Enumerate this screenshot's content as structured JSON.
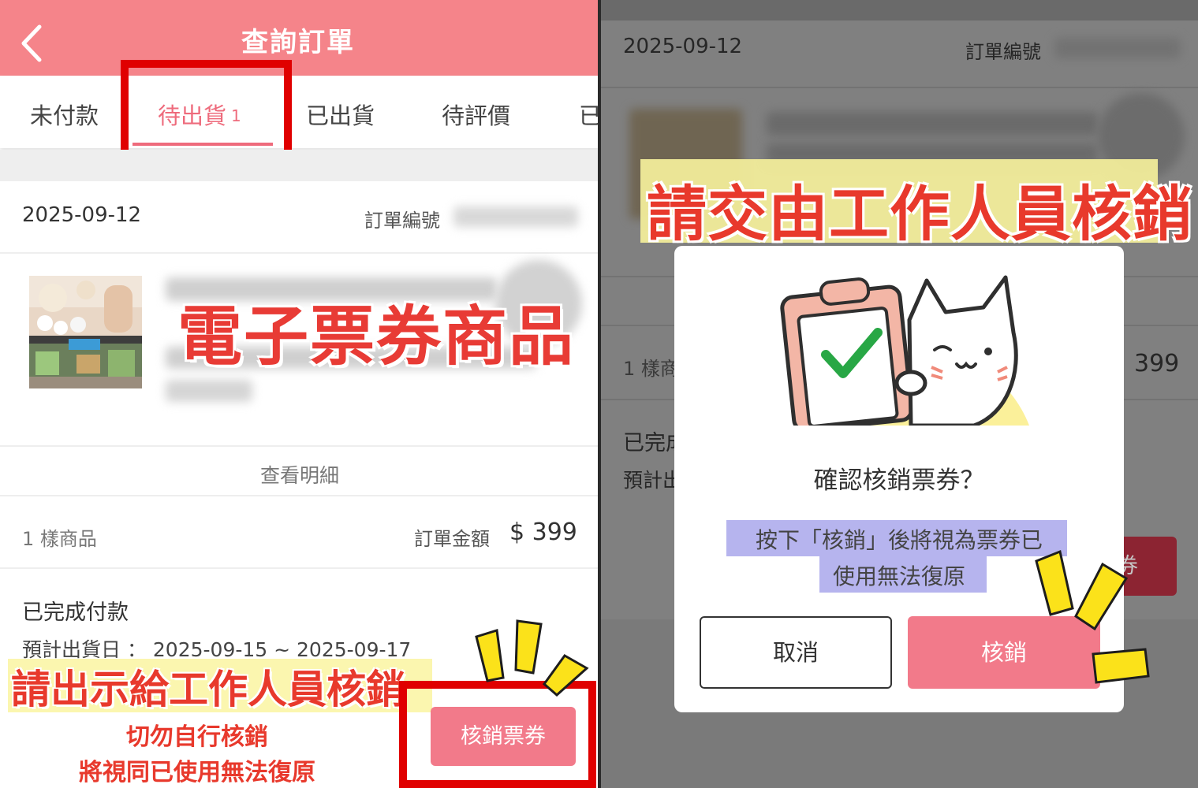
{
  "left": {
    "header": {
      "title": "查詢訂單"
    },
    "tabs": [
      {
        "label": "未付款"
      },
      {
        "label": "待出貨",
        "badge": "1"
      },
      {
        "label": "已出貨"
      },
      {
        "label": "待評價"
      },
      {
        "label": "已"
      }
    ],
    "order": {
      "date": "2025-09-12",
      "order_no_label": "訂單編號",
      "view_detail": "查看明細",
      "item_count": "1 樣商品",
      "amount_label": "訂單金額",
      "amount": "$ 399",
      "paid_status": "已完成付款",
      "ship_date": "預計出貨日 ： 2025-09-15 ~ 2025-09-17",
      "redeem_button": "核銷票券"
    },
    "annotations": {
      "product_overlay": "電子票券商品",
      "show_staff": "請出示給工作人員核銷",
      "warning_line1": "切勿自行核銷",
      "warning_line2": "將視同已使用無法復原"
    }
  },
  "right": {
    "background": {
      "date": "2025-09-12",
      "order_no_label": "訂單編號",
      "item_count": "1 樣商",
      "amount": "399",
      "paid_status": "已完成",
      "ship_date": "預計出",
      "button_fragment": "券"
    },
    "annotation": "請交由工作人員核銷",
    "dialog": {
      "title": "確認核銷票券？",
      "message_line1": "按下「核銷」後將視為票券已",
      "message_line2": "使用無法復原",
      "cancel_label": "取消",
      "confirm_label": "核銷"
    }
  },
  "colors": {
    "brand_pink": "#f5848a",
    "button_pink": "#f27a8a",
    "active_tab": "#ee6b7c",
    "highlight_red": "#e00000",
    "annotation_red": "#e8392c",
    "annotation_yellow": "#fbf5a8",
    "message_highlight": "#b6b4ee"
  },
  "icons": [
    "back-arrow-icon",
    "checkmark-icon",
    "cat-mascot-icon",
    "sparkle-burst-icon"
  ]
}
